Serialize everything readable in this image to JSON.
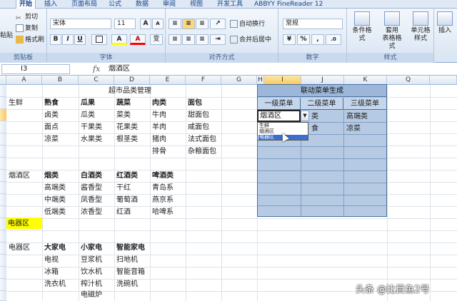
{
  "ribbon_tabs": [
    {
      "label": "开始",
      "active": true
    },
    {
      "label": "插入",
      "active": false
    },
    {
      "label": "页面布局",
      "active": false
    },
    {
      "label": "公式",
      "active": false
    },
    {
      "label": "数据",
      "active": false
    },
    {
      "label": "审阅",
      "active": false
    },
    {
      "label": "视图",
      "active": false
    },
    {
      "label": "开发工具",
      "active": false
    },
    {
      "label": "ABBYY FineReader 12",
      "active": false
    }
  ],
  "clipboard": {
    "paste": "粘贴",
    "cut": "剪切",
    "copy": "复制",
    "format_painter": "格式刷",
    "label": "剪贴板"
  },
  "font": {
    "name": "宋体",
    "size": "11",
    "bold": "B",
    "italic": "I",
    "underline": "U",
    "grow": "A",
    "shrink": "A",
    "fill_color": "A",
    "text_color": "A",
    "wen": "变",
    "label": "字体"
  },
  "alignment": {
    "wrap": "自动换行",
    "merge": "合并后居中",
    "label": "对齐方式"
  },
  "number": {
    "format": "常规",
    "percent": "%",
    "comma": ",",
    "label": "数字"
  },
  "styles": {
    "conditional": "条件格式",
    "table_line1": "套用",
    "table_line2": "表格格式",
    "cell_line1": "单元格",
    "cell_line2": "样式",
    "label": "样式"
  },
  "cells": {
    "insert": "插入"
  },
  "formula_bar": {
    "name_box": "I3",
    "fx": "fx",
    "value": "烟酒区"
  },
  "columns": [
    "A",
    "B",
    "C",
    "D",
    "E",
    "F",
    "G",
    "H",
    "I",
    "J",
    "K",
    "Q"
  ],
  "row_numbers": [
    "1",
    "2",
    "3",
    "4",
    "5",
    "6",
    "7",
    "8",
    "9",
    "10",
    "11",
    "12",
    "13",
    "14",
    "15",
    "16",
    "17",
    "18"
  ],
  "sheet": {
    "title": "超市品类管理",
    "fresh": {
      "label": "生鲜",
      "headers": [
        "熟食",
        "瓜果",
        "蔬菜",
        "肉类",
        "面包"
      ],
      "rows": [
        [
          "卤类",
          "瓜类",
          "菜类",
          "牛肉",
          "甜面包"
        ],
        [
          "面点",
          "干果类",
          "花果类",
          "羊肉",
          "咸面包"
        ],
        [
          "凉菜",
          "水果类",
          "根茎类",
          "猪肉",
          "法式面包"
        ],
        [
          "",
          "",
          "",
          "排骨",
          "杂粮面包"
        ]
      ]
    },
    "tobacco": {
      "label": "烟酒区",
      "headers": [
        "烟类",
        "白酒类",
        "红酒类",
        "啤酒类"
      ],
      "rows": [
        [
          "高端类",
          "酱香型",
          "干红",
          "青岛系"
        ],
        [
          "中端类",
          "凤香型",
          "葡萄酒",
          "燕京系"
        ],
        [
          "低端类",
          "浓香型",
          "红酒",
          "哈啤系"
        ]
      ]
    },
    "appliance_highlight": "电器区",
    "appliance": {
      "label": "电器区",
      "headers": [
        "大家电",
        "小家电",
        "智能家电"
      ],
      "rows": [
        [
          "电视",
          "豆浆机",
          "扫地机"
        ],
        [
          "冰箱",
          "饮水机",
          "智能音箱"
        ],
        [
          "洗衣机",
          "榨汁机",
          "洗碗机"
        ],
        [
          "",
          "电磁炉",
          ""
        ]
      ]
    }
  },
  "panel": {
    "title": "联动菜单生成",
    "headers": [
      "一级菜单",
      "二级菜单",
      "三级菜单"
    ],
    "row1": {
      "level1": "烟酒区",
      "level2": "类",
      "level3": "高端类"
    },
    "row2": {
      "level2": "食",
      "level3": "凉菜"
    },
    "dropdown_arrow": "▼",
    "dropdown_options": [
      "生鲜",
      "烟酒区",
      "电器区"
    ]
  },
  "watermark": "头条 @比目鱼2号",
  "colors": {
    "highlight_yellow": "#ffff00",
    "panel_blue": "#b6cbe3",
    "dropdown_highlight": "#3a6fd0"
  }
}
